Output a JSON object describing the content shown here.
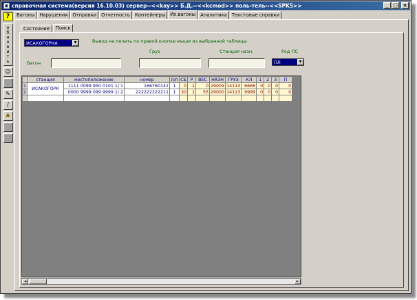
{
  "window": {
    "title": "справочная система(версия 16.10.03) сервер--<<kay>> Б.Д.--<<kcmod>> поль-тель--<<SPK5>>",
    "minimize": "_",
    "maximize": "□",
    "close": "×"
  },
  "left_toolbar": {
    "help": "?",
    "refresh_letters": [
      "о",
      "б",
      "н",
      "о",
      "в",
      "и",
      "т",
      "ь"
    ]
  },
  "tabs": [
    "Вагоны",
    "Нарушения",
    "Отправки",
    "Отчетность",
    "Контейнеры",
    "Их.вагоны",
    "Аналитика",
    "Текстовые справки"
  ],
  "active_tab": "Их.вагоны",
  "subtabs": [
    "Состояние",
    "Поиск"
  ],
  "active_subtab": "Поиск",
  "station_select": "ИСАКОГОРКА",
  "print_hint": "Вывод на печать по правой кнопке мыши из выбранной таблицы",
  "labels": {
    "wagon": "Вагон",
    "cargo": "Груз",
    "dest_station": "Станция назн.",
    "rod_ps": "Род ПС"
  },
  "rod_ps_value": "ПЛ",
  "table": {
    "left_headers": [
      "станция",
      "местоположение",
      "номер",
      "п/п"
    ],
    "right_headers": [
      "СБ",
      "Р",
      "ВЕС",
      "НАЗН",
      "ГРУЗ",
      "КЛ",
      "1",
      "2",
      "3",
      "П"
    ],
    "station": "ИСАКОГОРК",
    "rows": [
      {
        "rn": "1",
        "location": "1111 0099 950 0101  1/ 1",
        "number": "166760141",
        "pp": "1",
        "right": [
          "0",
          "1",
          "0",
          "29009",
          "14113",
          "6666",
          "0",
          "0",
          "0",
          "0"
        ]
      },
      {
        "rn": "2",
        "location": "0000 9999 099 9999  1/ 2",
        "number": "222222222211",
        "pp": "1",
        "right": [
          "30",
          "1",
          "55",
          "29000",
          "14113",
          "9999",
          "0",
          "0",
          "0",
          "0"
        ]
      }
    ]
  },
  "scroll": {
    "left": "◄",
    "right": "►"
  },
  "colors": {
    "title_bar": "#0a246a",
    "selection": "#000080",
    "grid_bg": "#808080",
    "data_cell": "#fff8d0"
  }
}
